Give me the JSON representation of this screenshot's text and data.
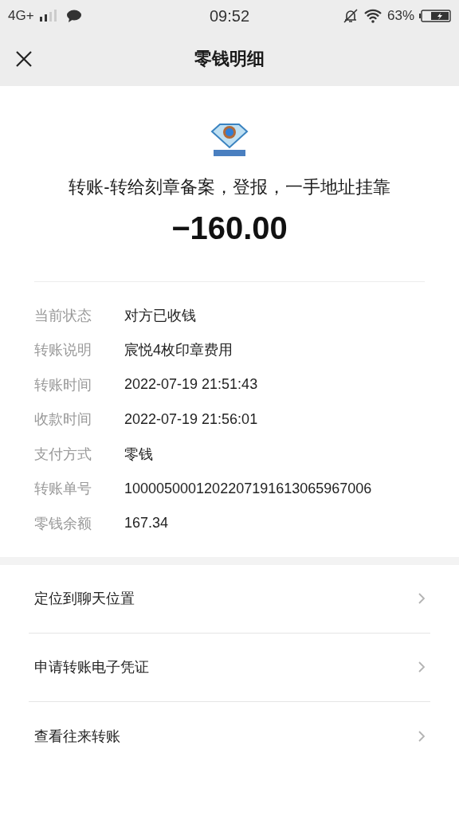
{
  "status_bar": {
    "network": "4G+",
    "time": "09:52",
    "battery": "63%"
  },
  "nav": {
    "title": "零钱明细"
  },
  "transfer": {
    "title": "转账-转给刻章备案，登报，一手地址挂靠",
    "amount": "−160.00"
  },
  "details": [
    {
      "label": "当前状态",
      "value": "对方已收钱"
    },
    {
      "label": "转账说明",
      "value": "宸悦4枚印章费用"
    },
    {
      "label": "转账时间",
      "value": "2022-07-19 21:51:43"
    },
    {
      "label": "收款时间",
      "value": "2022-07-19 21:56:01"
    },
    {
      "label": "支付方式",
      "value": "零钱"
    },
    {
      "label": "转账单号",
      "value": "1000050001202207191613065967006"
    },
    {
      "label": "零钱余额",
      "value": "167.34"
    }
  ],
  "actions": [
    {
      "label": "定位到聊天位置"
    },
    {
      "label": "申请转账电子凭证"
    },
    {
      "label": "查看往来转账"
    }
  ]
}
